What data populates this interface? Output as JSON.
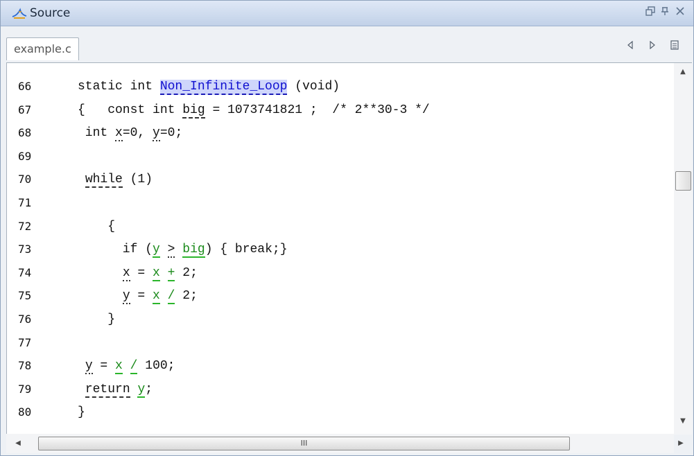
{
  "window": {
    "title": "Source",
    "icon": "polyspace-logo-icon",
    "buttons": {
      "restore": "restore-icon",
      "pin": "pin-icon",
      "close": "close-icon"
    }
  },
  "tabs": [
    {
      "label": "example.c",
      "active": true
    }
  ],
  "toolbar": {
    "prev": "previous-icon",
    "next": "next-icon",
    "menu": "list-icon"
  },
  "editor": {
    "lines": [
      {
        "n": "66",
        "tokens": [
          {
            "t": "static int "
          },
          {
            "t": "Non_Infinite_Loop",
            "s": "hl"
          },
          {
            "t": " (void)"
          }
        ]
      },
      {
        "n": "67",
        "tokens": [
          {
            "t": "{   const int "
          },
          {
            "t": "big",
            "s": "dash"
          },
          {
            "t": " = 1073741821 ;  /* 2**30-3 */"
          }
        ]
      },
      {
        "n": "68",
        "tokens": [
          {
            "t": " int "
          },
          {
            "t": "x",
            "s": "dot"
          },
          {
            "t": "=0, "
          },
          {
            "t": "y",
            "s": "dot"
          },
          {
            "t": "=0;"
          }
        ]
      },
      {
        "n": "69",
        "tokens": []
      },
      {
        "n": "70",
        "tokens": [
          {
            "t": " "
          },
          {
            "t": "while",
            "s": "dash"
          },
          {
            "t": " (1)"
          }
        ]
      },
      {
        "n": "71",
        "tokens": []
      },
      {
        "n": "72",
        "tokens": [
          {
            "t": "    {"
          }
        ]
      },
      {
        "n": "73",
        "tokens": [
          {
            "t": "      if ("
          },
          {
            "t": "y",
            "s": "green"
          },
          {
            "t": " "
          },
          {
            "t": ">",
            "s": "dot"
          },
          {
            "t": " "
          },
          {
            "t": "big",
            "s": "green"
          },
          {
            "t": ") { break;}"
          }
        ]
      },
      {
        "n": "74",
        "tokens": [
          {
            "t": "      "
          },
          {
            "t": "x",
            "s": "dot"
          },
          {
            "t": " = "
          },
          {
            "t": "x",
            "s": "green"
          },
          {
            "t": " "
          },
          {
            "t": "+",
            "s": "green"
          },
          {
            "t": " 2;"
          }
        ]
      },
      {
        "n": "75",
        "tokens": [
          {
            "t": "      "
          },
          {
            "t": "y",
            "s": "dot"
          },
          {
            "t": " = "
          },
          {
            "t": "x",
            "s": "green"
          },
          {
            "t": " "
          },
          {
            "t": "/",
            "s": "green"
          },
          {
            "t": " 2;"
          }
        ]
      },
      {
        "n": "76",
        "tokens": [
          {
            "t": "    }"
          }
        ]
      },
      {
        "n": "77",
        "tokens": []
      },
      {
        "n": "78",
        "tokens": [
          {
            "t": " "
          },
          {
            "t": "y",
            "s": "dot"
          },
          {
            "t": " = "
          },
          {
            "t": "x",
            "s": "green"
          },
          {
            "t": " "
          },
          {
            "t": "/",
            "s": "green"
          },
          {
            "t": " 100;"
          }
        ]
      },
      {
        "n": "79",
        "tokens": [
          {
            "t": " "
          },
          {
            "t": "return",
            "s": "dash"
          },
          {
            "t": " "
          },
          {
            "t": "y",
            "s": "green"
          },
          {
            "t": ";"
          }
        ]
      },
      {
        "n": "80",
        "tokens": [
          {
            "t": "}"
          }
        ]
      }
    ]
  },
  "scrollbars": {
    "hthumb_grip": "III"
  },
  "colors": {
    "highlight_bg": "#cfd6fb",
    "highlight_text": "#1010d0",
    "proven_green": "#2bb52b",
    "title_gradient_top": "#dfe8f6",
    "title_gradient_bottom": "#c1d1e8"
  }
}
